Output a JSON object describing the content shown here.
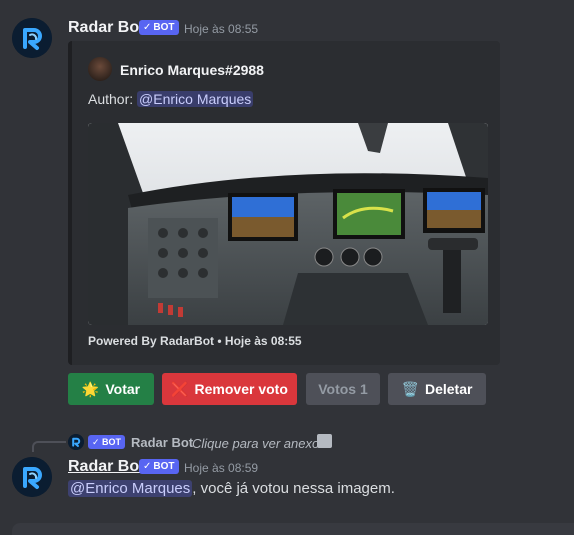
{
  "message1": {
    "username": "Radar Bot",
    "bot_tag": "BOT",
    "timestamp": "Hoje às 08:55",
    "embed": {
      "author_name": "Enrico Marques#2988",
      "description_prefix": "Author: ",
      "description_mention": "@Enrico Marques",
      "footer": "Powered By RadarBot • Hoje às 08:55"
    },
    "buttons": {
      "vote_emoji": "🌟",
      "vote_label": "Votar",
      "remove_emoji": "❌",
      "remove_label": "Remover voto",
      "votes_label": "Votos 1",
      "delete_emoji": "🗑️",
      "delete_label": "Deletar"
    }
  },
  "reply": {
    "bot_tag": "BOT",
    "username": "Radar Bot",
    "text": "Clique para ver anexo"
  },
  "message2": {
    "username": "Radar Bot",
    "bot_tag": "BOT",
    "timestamp": "Hoje às 08:59",
    "mention": "@Enrico Marques",
    "text": ", você já votou nessa imagem."
  },
  "colors": {
    "background": "#313338",
    "embed_bg": "#2b2d31",
    "blurple": "#5865f2",
    "success": "#248046",
    "danger": "#da373c",
    "secondary": "#4e5058"
  }
}
